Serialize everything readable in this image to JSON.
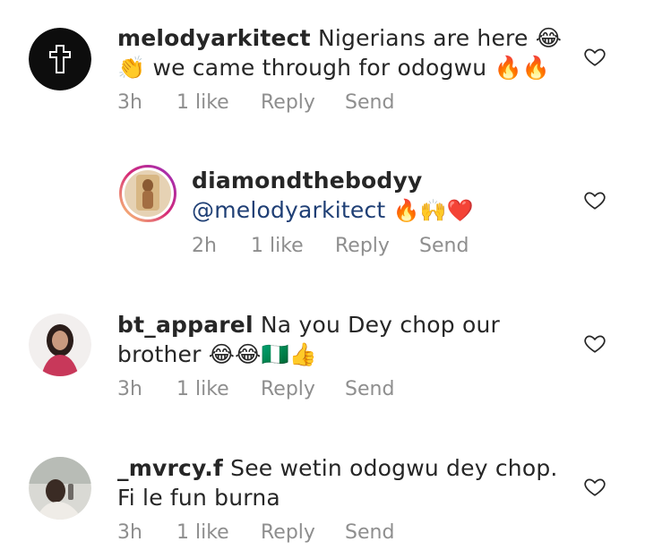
{
  "comments": [
    {
      "username": "melodyarkitect",
      "text_line1": "Nigerians are here 😂",
      "text_line2": "👏 we came through for odogwu 🔥🔥",
      "time": "3h",
      "likes": "1 like",
      "reply": "Reply",
      "send": "Send",
      "avatar": "cross-logo-icon"
    },
    {
      "username": "diamondthebodyy",
      "mention": "@melodyarkitect",
      "emojis": "🔥🙌❤️",
      "time": "2h",
      "likes": "1 like",
      "reply": "Reply",
      "send": "Send",
      "avatar": "profile-photo"
    },
    {
      "username": "bt_apparel",
      "text_line1": "Na you Dey chop our",
      "text_line2": "brother 😂😂🇳🇬👍",
      "time": "3h",
      "likes": "1 like",
      "reply": "Reply",
      "send": "Send",
      "avatar": "profile-photo"
    },
    {
      "username": "_mvrcy.f",
      "text_line1": "See wetin odogwu dey chop.",
      "text_line2": "Fi le fun burna",
      "time": "3h",
      "likes": "1 like",
      "reply": "Reply",
      "send": "Send",
      "avatar": "profile-photo"
    }
  ],
  "icons": {
    "like": "heart-outline-icon"
  }
}
